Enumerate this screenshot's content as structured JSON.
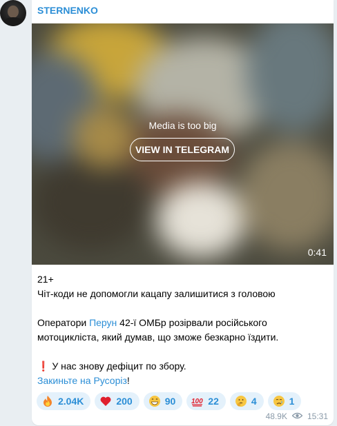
{
  "channel": {
    "name": "STERNENKO"
  },
  "media": {
    "notice": "Media is too big",
    "button_label": "VIEW IN TELEGRAM",
    "duration": "0:41"
  },
  "post": {
    "line1": "21+",
    "line2": "Чіт-коди не допомогли кацапу залишитися з головою",
    "para2_prefix": "Оператори ",
    "para2_link": "Перун",
    "para2_rest_line1": " 42-ї ОМБр розірвали російського",
    "para2_line2": "мотоцикліста, який думав, що зможе безкарно їздити.",
    "warning_icon": "❗",
    "warning_text": " У нас знову дефіцит по збору.",
    "cta_link": "Закиньте на Русоріз",
    "cta_suffix": "!"
  },
  "reactions": [
    {
      "icon": "fire-emoji",
      "count": "2.04K"
    },
    {
      "icon": "heart-emoji",
      "count": "200"
    },
    {
      "icon": "grin-emoji",
      "count": "90"
    },
    {
      "icon": "hundred-emoji",
      "count": "22"
    },
    {
      "icon": "thinking-emoji",
      "count": "4"
    },
    {
      "icon": "crying-emoji",
      "count": "1"
    }
  ],
  "meta": {
    "views": "48.9K",
    "time": "15:31"
  },
  "colors": {
    "accent": "#2b8ed6",
    "reaction_bg": "#e4f1fb",
    "background": "#e9eef2"
  }
}
